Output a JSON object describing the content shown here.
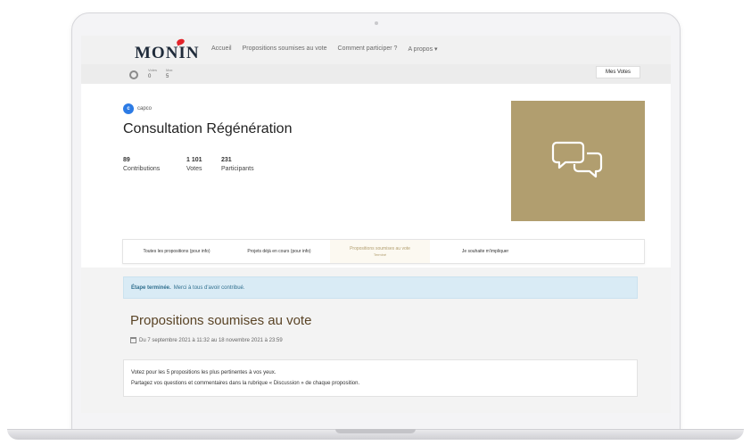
{
  "nav": {
    "logo": "MONIN",
    "links": [
      "Accueil",
      "Propositions soumises au vote",
      "Comment participer ?",
      "A propos ▾"
    ]
  },
  "votebar": {
    "votes_label": "Votes",
    "votes_value": "0",
    "max_label": "Max",
    "max_value": "5",
    "mes_votes": "Mes Votes"
  },
  "hero": {
    "author_initial": "c",
    "author_name": "capco",
    "title": "Consultation Régénération",
    "stats": [
      {
        "value": "89",
        "label": "Contributions"
      },
      {
        "value": "1 101",
        "label": "Votes"
      },
      {
        "value": "231",
        "label": "Participants"
      }
    ]
  },
  "steps": [
    {
      "label": "Toutes les propositions (pour info)",
      "sub": ""
    },
    {
      "label": "Projets déjà en cours (pour info)",
      "sub": ""
    },
    {
      "label": "Propositions soumises au vote",
      "sub": "Terminé"
    },
    {
      "label": "Je souhaite m'impliquer",
      "sub": ""
    }
  ],
  "alert": {
    "strong": "Étape terminée.",
    "text": "Merci à tous d'avoir contribué."
  },
  "section": {
    "title": "Propositions soumises au vote",
    "dates": "Du 7 septembre 2021 à 11:32 au 18 novembre 2021 à 23:59",
    "line1": "Votez pour les 5 propositions les plus pertinentes à vos yeux.",
    "line2": "Partagez vos questions et commentaires dans la rubrique « Discussion » de chaque proposition."
  },
  "colors": {
    "accent": "#b19e6f",
    "avatar": "#2c7be5",
    "alert_bg": "#d9ebf5",
    "title": "#5a4426"
  }
}
